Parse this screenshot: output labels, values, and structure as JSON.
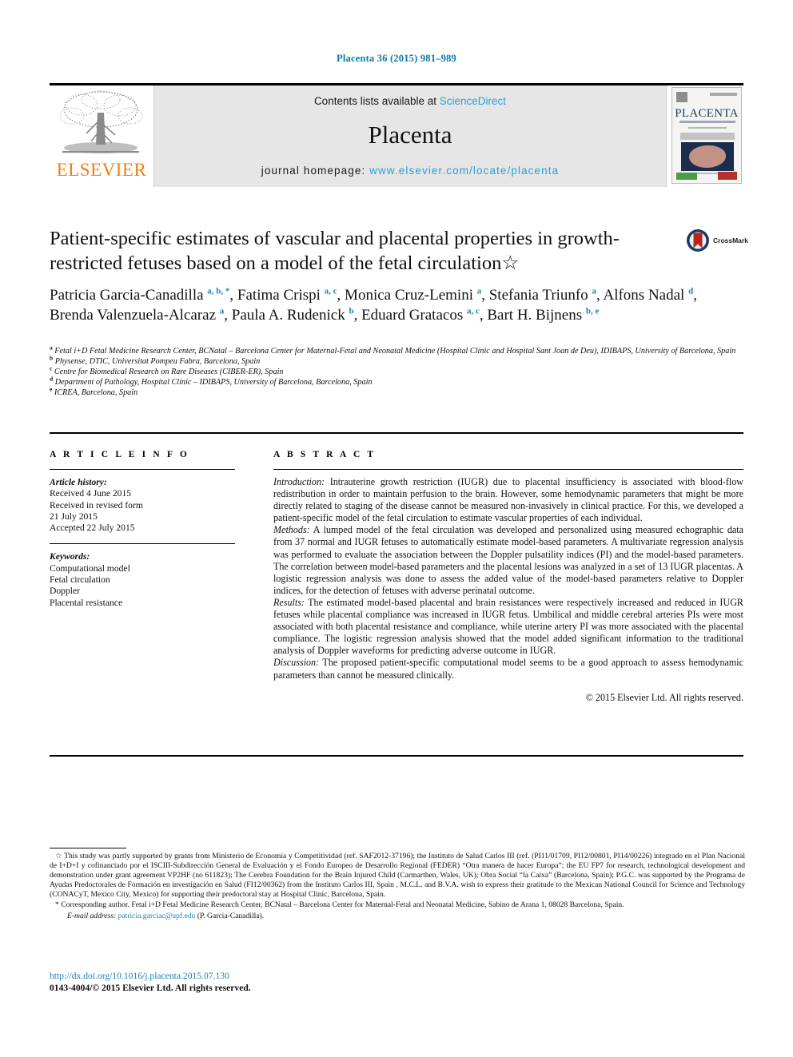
{
  "running_head": "Placenta 36 (2015) 981–989",
  "masthead": {
    "publisher": "ELSEVIER",
    "contents_prefix": "Contents lists available at ",
    "contents_link": "ScienceDirect",
    "journal_title": "Placenta",
    "homepage_prefix": "journal homepage: ",
    "homepage_url": "www.elsevier.com/locate/placenta",
    "cover_title": "PLACENTA"
  },
  "crossmark": {
    "label": "CrossMark"
  },
  "article": {
    "title": "Patient-specific estimates of vascular and placental properties in growth-restricted fetuses based on a model of the fetal circulation☆"
  },
  "authors": [
    {
      "name": "Patricia Garcia-Canadilla",
      "marks": "a, b, *"
    },
    {
      "name": "Fatima Crispi",
      "marks": "a, c"
    },
    {
      "name": "Monica Cruz-Lemini",
      "marks": "a"
    },
    {
      "name": "Stefania Triunfo",
      "marks": "a"
    },
    {
      "name": "Alfons Nadal",
      "marks": "d"
    },
    {
      "name": "Brenda Valenzuela-Alcaraz",
      "marks": "a"
    },
    {
      "name": "Paula A. Rudenick",
      "marks": "b"
    },
    {
      "name": "Eduard Gratacos",
      "marks": "a, c"
    },
    {
      "name": "Bart H. Bijnens",
      "marks": "b, e"
    }
  ],
  "affiliations": [
    {
      "mark": "a",
      "text": "Fetal i+D Fetal Medicine Research Center, BCNatal – Barcelona Center for Maternal-Fetal and Neonatal Medicine (Hospital Clínic and Hospital Sant Joan de Deu), IDIBAPS, University of Barcelona, Spain"
    },
    {
      "mark": "b",
      "text": "Physense, DTIC, Universitat Pompeu Fabra, Barcelona, Spain"
    },
    {
      "mark": "c",
      "text": "Centre for Biomedical Research on Rare Diseases (CIBER-ER), Spain"
    },
    {
      "mark": "d",
      "text": "Department of Pathology, Hospital Clínic – IDIBAPS, University of Barcelona, Barcelona, Spain"
    },
    {
      "mark": "e",
      "text": "ICREA, Barcelona, Spain"
    }
  ],
  "article_info": {
    "heading": "A R T I C L E   I N F O",
    "history_label": "Article history:",
    "history": [
      "Received 4 June 2015",
      "Received in revised form",
      "21 July 2015",
      "Accepted 22 July 2015"
    ],
    "keywords_label": "Keywords:",
    "keywords": [
      "Computational model",
      "Fetal circulation",
      "Doppler",
      "Placental resistance"
    ]
  },
  "abstract": {
    "heading": "A B S T R A C T",
    "sections": [
      {
        "label": "Introduction:",
        "text": " Intrauterine growth restriction (IUGR) due to placental insufficiency is associated with blood-flow redistribution in order to maintain perfusion to the brain. However, some hemodynamic parameters that might be more directly related to staging of the disease cannot be measured non-invasively in clinical practice. For this, we developed a patient-specific model of the fetal circulation to estimate vascular properties of each individual."
      },
      {
        "label": "Methods:",
        "text": " A lumped model of the fetal circulation was developed and personalized using measured echographic data from 37 normal and IUGR fetuses to automatically estimate model-based parameters. A multivariate regression analysis was performed to evaluate the association between the Doppler pulsatility indices (PI) and the model-based parameters. The correlation between model-based parameters and the placental lesions was analyzed in a set of 13 IUGR placentas. A logistic regression analysis was done to assess the added value of the model-based parameters relative to Doppler indices, for the detection of fetuses with adverse perinatal outcome."
      },
      {
        "label": "Results:",
        "text": " The estimated model-based placental and brain resistances were respectively increased and reduced in IUGR fetuses while placental compliance was increased in IUGR fetus. Umbilical and middle cerebral arteries PIs were most associated with both placental resistance and compliance, while uterine artery PI was more associated with the placental compliance. The logistic regression analysis showed that the model added significant information to the traditional analysis of Doppler waveforms for predicting adverse outcome in IUGR."
      },
      {
        "label": "Discussion:",
        "text": " The proposed patient-specific computational model seems to be a good approach to assess hemodynamic parameters than cannot be measured clinically."
      }
    ],
    "copyright": "© 2015 Elsevier Ltd. All rights reserved."
  },
  "footnotes": {
    "funding": "☆ This study was partly supported by grants from Ministerio de Economia y Competitividad (ref. SAF2012-37196); the Instituto de Salud Carlos III (ref. (PI11/01709, PI12/00801, PI14/00226) integrado en el Plan Nacional de I+D+I y cofinanciado por el ISCIII-Subdirección General de Evaluación y el Fondo Europeo de Desarrollo Regional (FEDER) “Otra manera de hacer Europa”; the EU FP7 for research, technological development and demonstration under grant agreement VP2HF (no 611823); The Cerebra Foundation for the Brain Injured Child (Carmarthen, Wales, UK); Obra Social “la Caixa” (Barcelona, Spain); P.G.C. was supported by the Programa de Ayudas Predoctorales de Formación en investigación en Salud (FI12/00362) from the Instituto Carlos III, Spain , M.C.L. and B.V.A. wish to express their gratitude to the Mexican National Council for Science and Technology (CONACyT, Mexico City, Mexico) for supporting their predoctoral stay at Hospital Clinic, Barcelona, Spain.",
    "corresponding": "* Corresponding author. Fetal i+D Fetal Medicine Research Center, BCNatal – Barcelona Center for Maternal-Fetal and Neonatal Medicine, Sabino de Arana 1, 08028 Barcelona, Spain.",
    "email_label": "E-mail address:",
    "email": "patricia.garciac@upf.edu",
    "email_owner": "(P. Garcia-Canadilla)."
  },
  "footer": {
    "doi": "http://dx.doi.org/10.1016/j.placenta.2015.07.130",
    "issn": "0143-4004/© 2015 Elsevier Ltd. All rights reserved."
  }
}
